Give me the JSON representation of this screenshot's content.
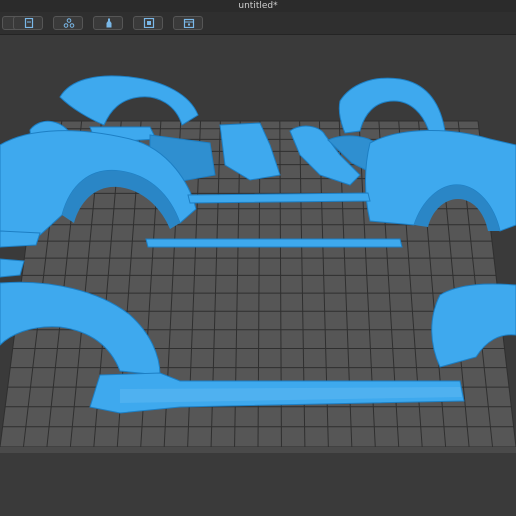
{
  "window": {
    "title": "untitled*"
  },
  "toolbar": {
    "buttons": [
      {
        "icon": "hamburger-menu-icon"
      },
      {
        "icon": "document-icon"
      },
      {
        "icon": "nodes-icon"
      },
      {
        "icon": "bottle-icon"
      },
      {
        "icon": "square-frame-icon"
      },
      {
        "icon": "calendar-icon"
      }
    ]
  },
  "viewport": {
    "bed_color": "#565656",
    "grid_color": "#2f2f2f",
    "part_color": "#3ea9ee",
    "part_shade_color": "#1d7fc4",
    "part_highlight_color": "#7ccaf7"
  }
}
